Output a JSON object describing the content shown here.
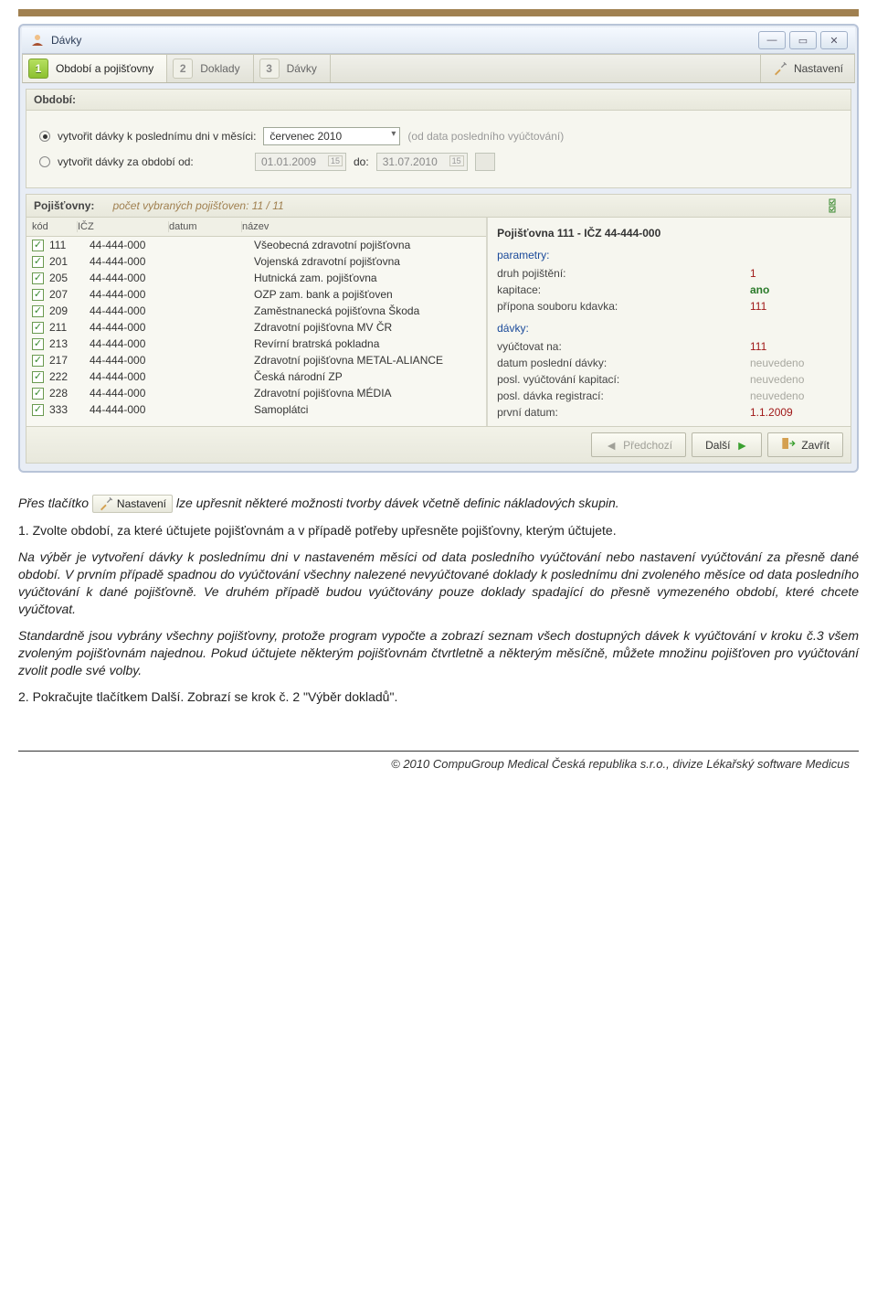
{
  "window": {
    "title": "Dávky"
  },
  "tabs": [
    {
      "num": "1",
      "label": "Období a pojišťovny",
      "active": true
    },
    {
      "num": "2",
      "label": "Doklady",
      "active": false
    },
    {
      "num": "3",
      "label": "Dávky",
      "active": false
    }
  ],
  "settings_btn": "Nastavení",
  "period": {
    "header": "Období:",
    "radio1_label": "vytvořit dávky k poslednímu dni v měsíci:",
    "radio1_value": "červenec 2010",
    "radio1_hint": "(od data posledního vyúčtování)",
    "radio2_label": "vytvořit dávky za období od:",
    "radio2_from": "01.01.2009",
    "radio2_do_label": "do:",
    "radio2_to": "31.07.2010"
  },
  "insurers": {
    "header": "Pojišťovny:",
    "count_info": "počet vybraných pojišťoven: 11 / 11",
    "columns": {
      "kod": "kód",
      "icz": "IČZ",
      "datum": "datum",
      "nazev": "název"
    },
    "rows": [
      {
        "kod": "111",
        "icz": "44-444-000",
        "datum": "",
        "nazev": "Všeobecná zdravotní pojišťovna"
      },
      {
        "kod": "201",
        "icz": "44-444-000",
        "datum": "",
        "nazev": "Vojenská zdravotní pojišťovna"
      },
      {
        "kod": "205",
        "icz": "44-444-000",
        "datum": "",
        "nazev": "Hutnická zam. pojišťovna"
      },
      {
        "kod": "207",
        "icz": "44-444-000",
        "datum": "",
        "nazev": "OZP zam. bank a pojišťoven"
      },
      {
        "kod": "209",
        "icz": "44-444-000",
        "datum": "",
        "nazev": "Zaměstnanecká pojišťovna Škoda"
      },
      {
        "kod": "211",
        "icz": "44-444-000",
        "datum": "",
        "nazev": "Zdravotní pojišťovna MV ČR"
      },
      {
        "kod": "213",
        "icz": "44-444-000",
        "datum": "",
        "nazev": "Revírní bratrská pokladna"
      },
      {
        "kod": "217",
        "icz": "44-444-000",
        "datum": "",
        "nazev": "Zdravotní pojišťovna METAL-ALIANCE"
      },
      {
        "kod": "222",
        "icz": "44-444-000",
        "datum": "",
        "nazev": "Česká národní ZP"
      },
      {
        "kod": "228",
        "icz": "44-444-000",
        "datum": "",
        "nazev": "Zdravotní pojišťovna MÉDIA"
      },
      {
        "kod": "333",
        "icz": "44-444-000",
        "datum": "",
        "nazev": "Samoplátci"
      }
    ]
  },
  "detail": {
    "title": "Pojišťovna 111 - IČZ 44-444-000",
    "params_label": "parametry:",
    "params": [
      {
        "k": "druh pojištění:",
        "v": "1",
        "cls": "v-red"
      },
      {
        "k": "kapitace:",
        "v": "ano",
        "cls": "v-green"
      },
      {
        "k": "přípona souboru kdavka:",
        "v": "111",
        "cls": "v-red"
      }
    ],
    "davky_label": "dávky:",
    "davky": [
      {
        "k": "vyúčtovat na:",
        "v": "111",
        "cls": "v-red"
      },
      {
        "k": "datum poslední dávky:",
        "v": "neuvedeno",
        "cls": "v-grey"
      },
      {
        "k": "posl. vyúčtování kapitací:",
        "v": "neuvedeno",
        "cls": "v-grey"
      },
      {
        "k": "posl. dávka registrací:",
        "v": "neuvedeno",
        "cls": "v-grey"
      },
      {
        "k": "první datum:",
        "v": "1.1.2009",
        "cls": "v-red"
      }
    ]
  },
  "footer": {
    "prev": "Předchozí",
    "next": "Další",
    "close": "Zavřít"
  },
  "doc": {
    "line1a": "Přes tlačítko",
    "inline_btn": "Nastavení",
    "line1b": "lze upřesnit některé možnosti tvorby dávek včetně definic nákladových skupin.",
    "line2": "1. Zvolte období, za které účtujete pojišťovnám a v případě potřeby upřesněte pojišťovny, kterým účtujete.",
    "line3": "Na výběr je vytvoření dávky k poslednímu dni v nastaveném měsíci od data posledního vyúčtování nebo nastavení vyúčtování za přesně dané období. V prvním případě spadnou do vyúčtování všechny nalezené nevyúčtované doklady k poslednímu dni zvoleného měsíce od data posledního vyúčtování k dané pojišťovně. Ve druhém případě budou vyúčtovány pouze doklady spadající do přesně vymezeného období, které chcete vyúčtovat.",
    "line4": "Standardně jsou vybrány všechny pojišťovny, protože program vypočte a zobrazí seznam všech dostupných dávek k vyúčtování v kroku č.3 všem zvoleným pojišťovnám najednou. Pokud účtujete některým pojišťovnám čtvrtletně a některým měsíčně, můžete množinu pojišťoven pro vyúčtování zvolit podle své volby.",
    "line5": "2. Pokračujte tlačítkem Další. Zobrazí se krok č. 2 \"Výběr dokladů\"."
  },
  "copyright": "© 2010 CompuGroup Medical Česká republika s.r.o., divize Lékařský software Medicus"
}
